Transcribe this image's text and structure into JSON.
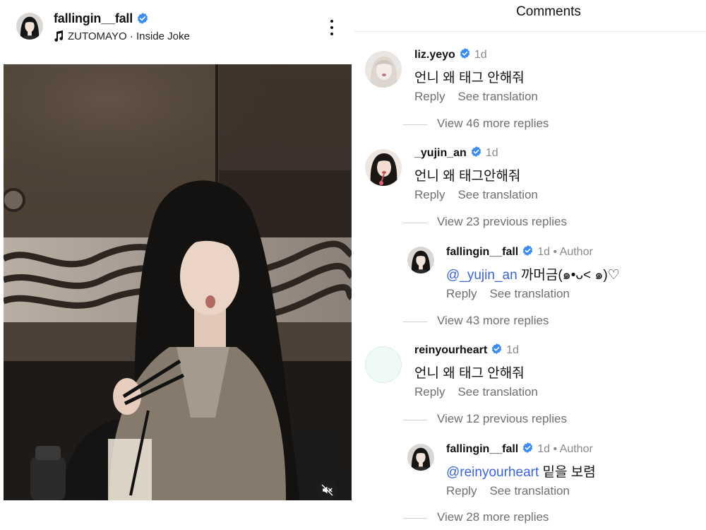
{
  "post": {
    "username": "fallingin__fall",
    "music": "ZUTOMAYO · Inside Joke",
    "icons": {
      "verified": "verified-badge-icon",
      "music": "music-note-icon",
      "more": "more-vertical-icon",
      "mute": "volume-muted-icon"
    }
  },
  "comments_panel": {
    "title": "Comments",
    "threads": [
      {
        "username": "liz.yeyo",
        "time": "1d",
        "text": "언니 왜 태그 안해줘",
        "reply_label": "Reply",
        "translate_label": "See translation",
        "view_more": "View 46 more replies"
      },
      {
        "username": "_yujin_an",
        "time": "1d",
        "text": "언니 왜 태그안해줘",
        "reply_label": "Reply",
        "translate_label": "See translation",
        "view_previous": "View 23 previous replies",
        "reply": {
          "username": "fallingin__fall",
          "time": "1d",
          "author_tag": "• Author",
          "mention": "@_yujin_an",
          "text": " 까머금(๑•ᴗ< ๑)♡",
          "reply_label": "Reply",
          "translate_label": "See translation"
        },
        "view_more": "View 43 more replies"
      },
      {
        "username": "reinyourheart",
        "time": "1d",
        "text": "언니 왜 태그 안해줘",
        "reply_label": "Reply",
        "translate_label": "See translation",
        "view_previous": "View 12 previous replies",
        "reply": {
          "username": "fallingin__fall",
          "time": "1d",
          "author_tag": "• Author",
          "mention": "@reinyourheart",
          "text": " 밑을 보렴",
          "reply_label": "Reply",
          "translate_label": "See translation"
        },
        "view_more": "View 28 more replies"
      }
    ]
  },
  "colors": {
    "verified": "#3b8cf0",
    "mention": "#3a63d8",
    "secondary_text": "#6f6f6f",
    "meta_text": "#8a8a8a"
  }
}
